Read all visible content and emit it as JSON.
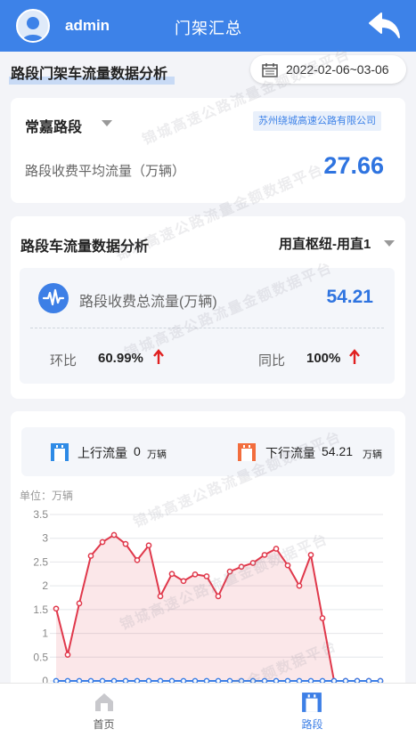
{
  "header": {
    "username": "admin",
    "title": "门架汇总"
  },
  "section1": {
    "title": "路段门架车流量数据分析",
    "date_range": "2022-02-06~03-06"
  },
  "road_card": {
    "road_name": "常嘉路段",
    "company": "苏州绕城高速公路有限公司",
    "avg_label": "路段收费平均流量（万辆）",
    "avg_value": "27.66"
  },
  "section2": {
    "title": "路段车流量数据分析",
    "interchange": "用直枢纽-用直1",
    "total_label": "路段收费总流量(万辆)",
    "total_value": "54.21",
    "mom_label": "环比",
    "mom_value": "60.99%",
    "yoy_label": "同比",
    "yoy_value": "100%"
  },
  "legend": {
    "up_label": "上行流量",
    "up_value": "0",
    "up_unit": "万辆",
    "down_label": "下行流量",
    "down_value": "54.21",
    "down_unit": "万辆"
  },
  "watermark": "锦城高速公路流量金额数据平台",
  "chart_data": {
    "type": "line",
    "ylabel": "单位：万辆",
    "ylim": [
      0,
      3.5
    ],
    "yticks": [
      "0",
      "0.5",
      "1",
      "1.5",
      "2",
      "2.5",
      "3",
      "3.5"
    ],
    "series": [
      {
        "name": "下行流量",
        "color": "#e0384b",
        "area": true,
        "values": [
          1.52,
          0.55,
          1.63,
          2.63,
          2.92,
          3.07,
          2.88,
          2.54,
          2.85,
          1.78,
          2.25,
          2.1,
          2.24,
          2.2,
          1.78,
          2.3,
          2.4,
          2.48,
          2.65,
          2.78,
          2.43,
          2.0,
          2.65,
          1.32,
          0,
          0,
          0,
          0,
          0
        ]
      },
      {
        "name": "上行流量",
        "color": "#3d7fe6",
        "area": false,
        "values": [
          0,
          0,
          0,
          0,
          0,
          0,
          0,
          0,
          0,
          0,
          0,
          0,
          0,
          0,
          0,
          0,
          0,
          0,
          0,
          0,
          0,
          0,
          0,
          0,
          0,
          0,
          0,
          0,
          0
        ]
      }
    ],
    "grid": true
  },
  "nav": {
    "home": "首页",
    "road": "路段"
  },
  "colors": {
    "primary": "#3d82e8",
    "accent_red": "#e0384b",
    "up_icon": "#2f8be6",
    "down_icon": "#f26d3d",
    "arrow_red": "#e02020"
  }
}
